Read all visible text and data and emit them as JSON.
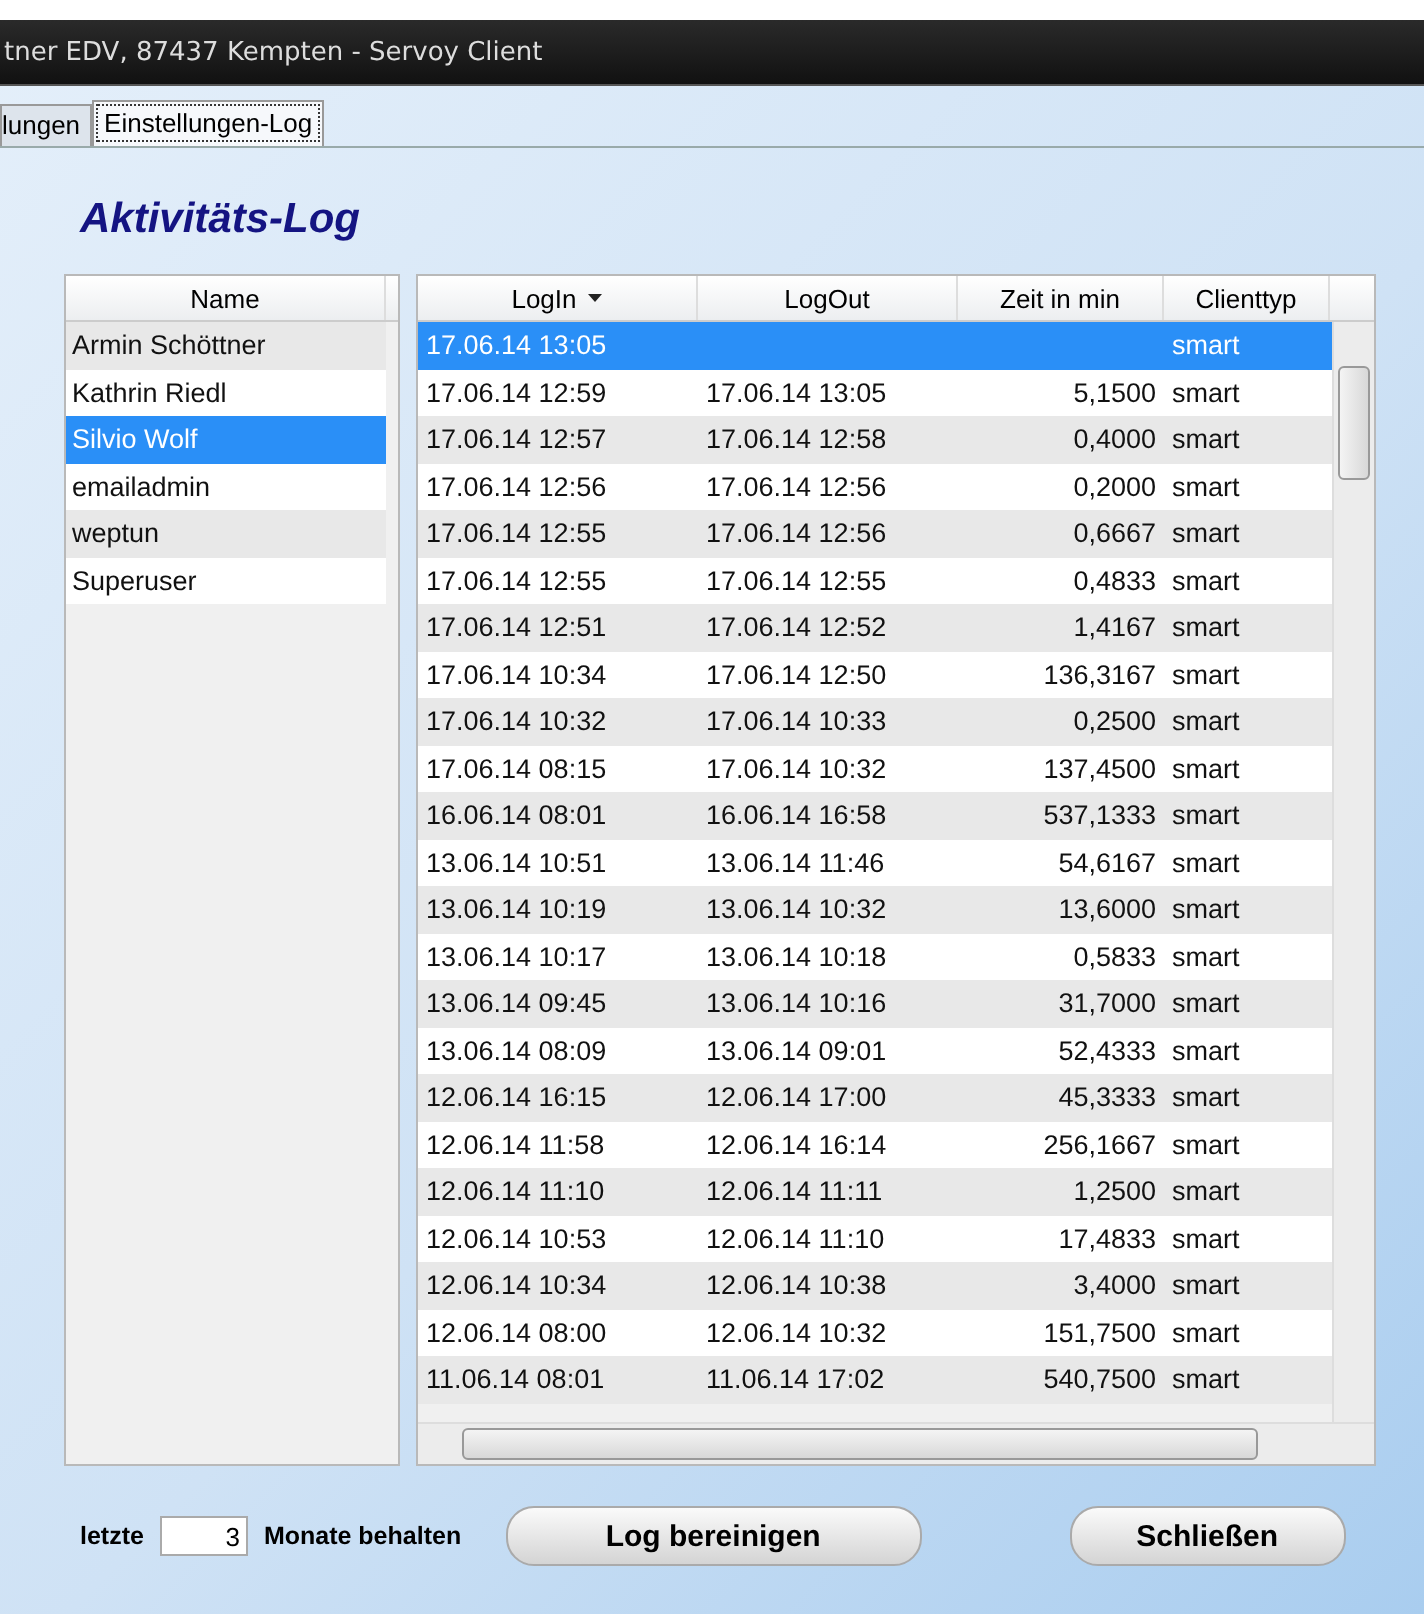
{
  "window": {
    "title": "tner EDV, 87437 Kempten  - Servoy Client"
  },
  "tabs": [
    {
      "label": "lungen",
      "selected": false
    },
    {
      "label": "Einstellungen-Log",
      "selected": true
    }
  ],
  "heading": "Aktivitäts-Log",
  "users": {
    "column": "Name",
    "rows": [
      {
        "name": "Armin Schöttner",
        "selected": false
      },
      {
        "name": "Kathrin Riedl",
        "selected": false
      },
      {
        "name": "Silvio Wolf",
        "selected": true
      },
      {
        "name": "emailadmin",
        "selected": false
      },
      {
        "name": "weptun",
        "selected": false
      },
      {
        "name": "Superuser",
        "selected": false
      }
    ]
  },
  "log": {
    "columns": [
      {
        "label": "LogIn",
        "sorted": true
      },
      {
        "label": "LogOut",
        "sorted": false
      },
      {
        "label": "Zeit in min",
        "sorted": false
      },
      {
        "label": "Clienttyp",
        "sorted": false
      }
    ],
    "rows": [
      {
        "login": "17.06.14 13:05",
        "logout": "",
        "minutes": "",
        "client": "smart",
        "selected": true
      },
      {
        "login": "17.06.14 12:59",
        "logout": "17.06.14 13:05",
        "minutes": "5,1500",
        "client": "smart",
        "selected": false
      },
      {
        "login": "17.06.14 12:57",
        "logout": "17.06.14 12:58",
        "minutes": "0,4000",
        "client": "smart",
        "selected": false
      },
      {
        "login": "17.06.14 12:56",
        "logout": "17.06.14 12:56",
        "minutes": "0,2000",
        "client": "smart",
        "selected": false
      },
      {
        "login": "17.06.14 12:55",
        "logout": "17.06.14 12:56",
        "minutes": "0,6667",
        "client": "smart",
        "selected": false
      },
      {
        "login": "17.06.14 12:55",
        "logout": "17.06.14 12:55",
        "minutes": "0,4833",
        "client": "smart",
        "selected": false
      },
      {
        "login": "17.06.14 12:51",
        "logout": "17.06.14 12:52",
        "minutes": "1,4167",
        "client": "smart",
        "selected": false
      },
      {
        "login": "17.06.14 10:34",
        "logout": "17.06.14 12:50",
        "minutes": "136,3167",
        "client": "smart",
        "selected": false
      },
      {
        "login": "17.06.14 10:32",
        "logout": "17.06.14 10:33",
        "minutes": "0,2500",
        "client": "smart",
        "selected": false
      },
      {
        "login": "17.06.14 08:15",
        "logout": "17.06.14 10:32",
        "minutes": "137,4500",
        "client": "smart",
        "selected": false
      },
      {
        "login": "16.06.14 08:01",
        "logout": "16.06.14 16:58",
        "minutes": "537,1333",
        "client": "smart",
        "selected": false
      },
      {
        "login": "13.06.14 10:51",
        "logout": "13.06.14 11:46",
        "minutes": "54,6167",
        "client": "smart",
        "selected": false
      },
      {
        "login": "13.06.14 10:19",
        "logout": "13.06.14 10:32",
        "minutes": "13,6000",
        "client": "smart",
        "selected": false
      },
      {
        "login": "13.06.14 10:17",
        "logout": "13.06.14 10:18",
        "minutes": "0,5833",
        "client": "smart",
        "selected": false
      },
      {
        "login": "13.06.14 09:45",
        "logout": "13.06.14 10:16",
        "minutes": "31,7000",
        "client": "smart",
        "selected": false
      },
      {
        "login": "13.06.14 08:09",
        "logout": "13.06.14 09:01",
        "minutes": "52,4333",
        "client": "smart",
        "selected": false
      },
      {
        "login": "12.06.14 16:15",
        "logout": "12.06.14 17:00",
        "minutes": "45,3333",
        "client": "smart",
        "selected": false
      },
      {
        "login": "12.06.14 11:58",
        "logout": "12.06.14 16:14",
        "minutes": "256,1667",
        "client": "smart",
        "selected": false
      },
      {
        "login": "12.06.14 11:10",
        "logout": "12.06.14 11:11",
        "minutes": "1,2500",
        "client": "smart",
        "selected": false
      },
      {
        "login": "12.06.14 10:53",
        "logout": "12.06.14 11:10",
        "minutes": "17,4833",
        "client": "smart",
        "selected": false
      },
      {
        "login": "12.06.14 10:34",
        "logout": "12.06.14 10:38",
        "minutes": "3,4000",
        "client": "smart",
        "selected": false
      },
      {
        "login": "12.06.14 08:00",
        "logout": "12.06.14 10:32",
        "minutes": "151,7500",
        "client": "smart",
        "selected": false
      },
      {
        "login": "11.06.14 08:01",
        "logout": "11.06.14 17:02",
        "minutes": "540,7500",
        "client": "smart",
        "selected": false
      }
    ]
  },
  "footer": {
    "label_before": "letzte",
    "months": "3",
    "label_after": "Monate behalten",
    "buttons": [
      "Log bereinigen",
      "Schließen"
    ]
  }
}
